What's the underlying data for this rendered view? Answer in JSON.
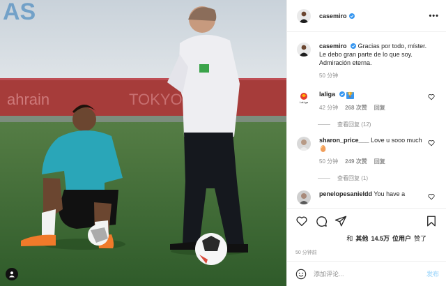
{
  "header": {
    "username": "casemiro",
    "more_icon": "•••"
  },
  "caption": {
    "username": "casemiro",
    "text": "Gracias por todo, míster. Le debo gran parte de lo que soy. Admiración eterna.",
    "time": "50 分钟"
  },
  "comments": [
    {
      "username": "laliga",
      "verified": true,
      "badge": "🏆",
      "text": "",
      "time": "42 分钟",
      "likes": "268 次赞",
      "reply": "回复",
      "view_replies": "查看回复 (12)"
    },
    {
      "username": "sharon_price___",
      "verified": false,
      "text": "Love u sooo much 🥚",
      "time": "50 分钟",
      "likes": "249 次赞",
      "reply": "回复",
      "view_replies": "查看回复 (1)"
    },
    {
      "username": "penelopesanieldd",
      "verified": false,
      "text": "You have a"
    }
  ],
  "actions": {
    "likes_prefix": "和",
    "likes_mid": "其他",
    "likes_count": "14.5万",
    "likes_users": "位用户",
    "likes_suffix": "赞了",
    "time": "50 分钟前"
  },
  "add_comment": {
    "placeholder": "添加评论...",
    "post_label": "发布"
  },
  "colors": {
    "link": "#0095f6",
    "post_disabled": "#b2dffc",
    "text": "#262626",
    "muted": "#8e8e8e",
    "verified": "#3897f0"
  },
  "icons": [
    "more-icon",
    "verified-icon",
    "heart-icon",
    "comment-icon",
    "share-icon",
    "bookmark-icon",
    "emoji-icon",
    "user-tag-icon"
  ]
}
